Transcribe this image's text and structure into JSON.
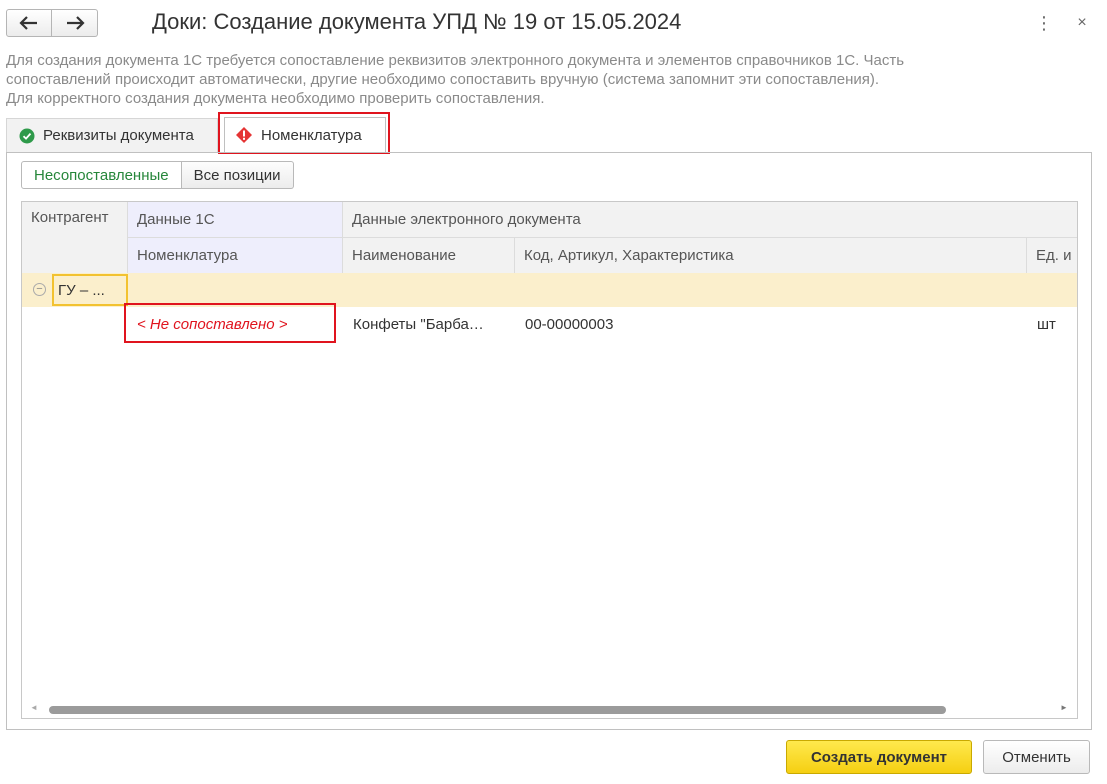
{
  "window": {
    "title": "Доки: Создание документа УПД № 19 от 15.05.2024",
    "more_icon": "⋮",
    "close_icon": "×"
  },
  "description": [
    "Для создания документа 1С требуется сопоставление реквизитов электронного документа и элементов справочников 1С. Часть",
    "сопоставлений происходит автоматически, другие необходимо сопоставить вручную (система запомнит эти сопоставления).",
    "Для корректного создания документа необходимо проверить сопоставления."
  ],
  "tabs": [
    {
      "label": "Реквизиты документа",
      "icon": "check-circle-icon",
      "status": "ok"
    },
    {
      "label": "Номенклатура",
      "icon": "warning-diamond-icon",
      "status": "error",
      "active": true
    }
  ],
  "filters": [
    {
      "label": "Несопоставленные",
      "active": true
    },
    {
      "label": "Все позиции",
      "active": false
    }
  ],
  "grid": {
    "headers": {
      "kontragent": "Контрагент",
      "data_1c": "Данные 1С",
      "nomenklatura": "Номенклатура",
      "data_edoc": "Данные электронного документа",
      "naimenovanie": "Наименование",
      "kod": "Код, Артикул, Характеристика",
      "ed": "Ед. и"
    },
    "group": {
      "label": "ГУ – ..."
    },
    "rows": [
      {
        "nomenklatura": "< Не сопоставлено >",
        "naimenovanie": "Конфеты \"Барба…",
        "kod": "00-00000003",
        "ed": "шт"
      }
    ]
  },
  "footer": {
    "create_label": "Создать документ",
    "cancel_label": "Отменить"
  },
  "colors": {
    "accent_yellow": "#f5cf12",
    "error_red": "#e0141e",
    "ok_green": "#26863a",
    "group_row": "#fbefcc"
  }
}
